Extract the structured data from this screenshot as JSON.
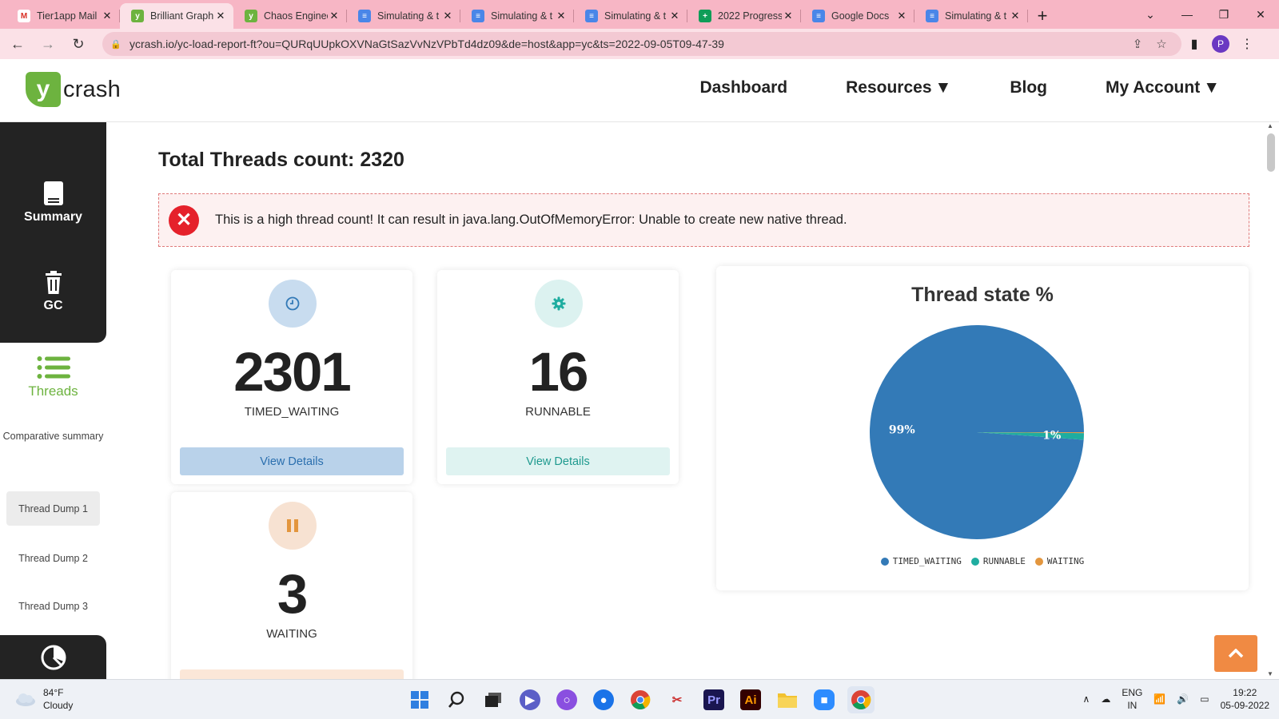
{
  "browser": {
    "tabs": [
      {
        "title": "Tier1app Mail",
        "favicon": "gmail-icon",
        "color": "#ffffff",
        "active": false
      },
      {
        "title": "Brilliant Graph",
        "favicon": "ycrash-icon",
        "color": "#6db33f",
        "active": true
      },
      {
        "title": "Chaos Enginee",
        "favicon": "ycrash-icon",
        "color": "#6db33f",
        "active": false
      },
      {
        "title": "Simulating & t",
        "favicon": "google-docs-icon",
        "color": "#4a86e8",
        "active": false
      },
      {
        "title": "Simulating & t",
        "favicon": "google-docs-icon",
        "color": "#4a86e8",
        "active": false
      },
      {
        "title": "Simulating & t",
        "favicon": "google-docs-icon",
        "color": "#4a86e8",
        "active": false
      },
      {
        "title": "2022 Progress",
        "favicon": "google-sheets-icon",
        "color": "#0f9d58",
        "active": false
      },
      {
        "title": "Google Docs",
        "favicon": "google-docs-icon",
        "color": "#4a86e8",
        "active": false
      },
      {
        "title": "Simulating & t",
        "favicon": "google-docs-icon",
        "color": "#4a86e8",
        "active": false
      }
    ],
    "url": "ycrash.io/yc-load-report-ft?ou=QURqUUpkOXVNaGtSazVvNzVPbTd4dz09&de=host&app=yc&ts=2022-09-05T09-47-39",
    "profile_initial": "P"
  },
  "site": {
    "logo_letter": "y",
    "logo_word": "crash",
    "nav": [
      "Dashboard",
      "Resources",
      "Blog",
      "My Account"
    ]
  },
  "sidebar": {
    "summary": "Summary",
    "gc": "GC",
    "threads": "Threads",
    "comparative": "Comparative summary",
    "dumps": [
      "Thread Dump 1",
      "Thread Dump 2",
      "Thread Dump 3"
    ]
  },
  "main": {
    "title": "Total Threads count: 2320",
    "alert": "This is a high thread count! It can result in java.lang.OutOfMemoryError: Unable to create new native thread.",
    "cards": [
      {
        "count": "2301",
        "state": "TIMED_WAITING",
        "button": "View Details"
      },
      {
        "count": "16",
        "state": "RUNNABLE",
        "button": "View Details"
      },
      {
        "count": "3",
        "state": "WAITING",
        "button": ""
      }
    ]
  },
  "chart_data": {
    "type": "pie",
    "title": "Thread state %",
    "slices": [
      {
        "label": "TIMED_WAITING",
        "value": 99,
        "display": "99%",
        "color": "#337ab7"
      },
      {
        "label": "RUNNABLE",
        "value": 1,
        "display": "1%",
        "color": "#1fada0"
      },
      {
        "label": "WAITING",
        "value": 0.13,
        "display": "",
        "color": "#e3963e"
      }
    ],
    "legend_placement": "bottom"
  },
  "taskbar": {
    "weather_temp": "84°F",
    "weather_desc": "Cloudy",
    "lang_top": "ENG",
    "lang_bottom": "IN",
    "time": "19:22",
    "date": "05-09-2022"
  }
}
